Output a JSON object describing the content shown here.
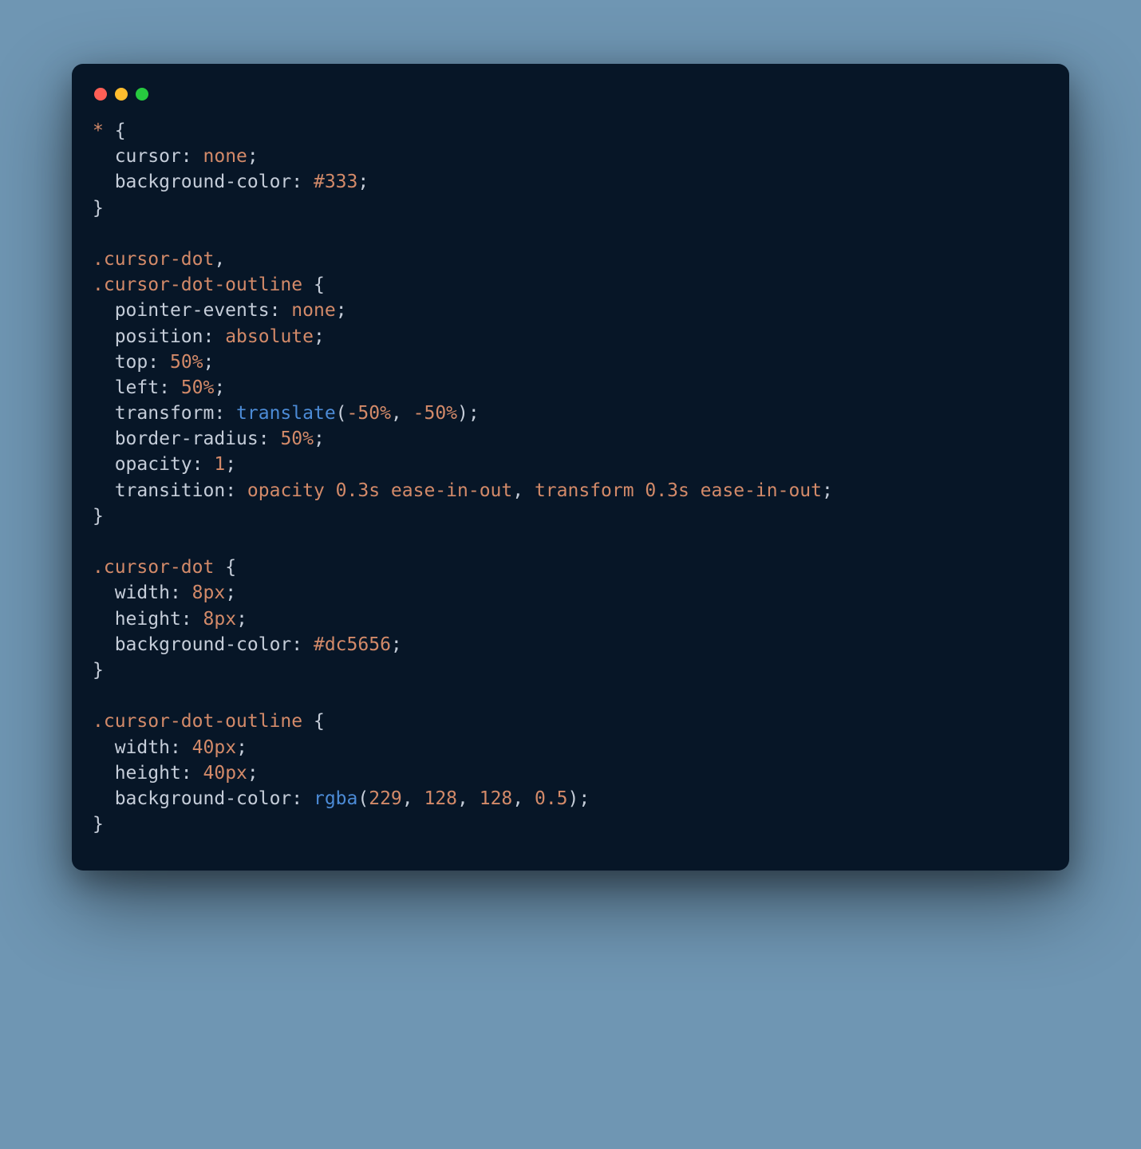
{
  "window": {
    "bg": "#071627",
    "traffic_lights": [
      "#ff5f56",
      "#ffbd2e",
      "#27c93f"
    ]
  },
  "code": {
    "rules": [
      {
        "selectors": [
          "*"
        ],
        "decls": [
          {
            "prop": "cursor",
            "tokens": [
              {
                "t": "val",
                "v": "none"
              }
            ]
          },
          {
            "prop": "background-color",
            "tokens": [
              {
                "t": "val",
                "v": "#333"
              }
            ]
          }
        ]
      },
      {
        "selectors": [
          ".cursor-dot",
          ".cursor-dot-outline"
        ],
        "decls": [
          {
            "prop": "pointer-events",
            "tokens": [
              {
                "t": "val",
                "v": "none"
              }
            ]
          },
          {
            "prop": "position",
            "tokens": [
              {
                "t": "val",
                "v": "absolute"
              }
            ]
          },
          {
            "prop": "top",
            "tokens": [
              {
                "t": "num",
                "v": "50%"
              }
            ]
          },
          {
            "prop": "left",
            "tokens": [
              {
                "t": "num",
                "v": "50%"
              }
            ]
          },
          {
            "prop": "transform",
            "tokens": [
              {
                "t": "func",
                "v": "translate"
              },
              {
                "t": "punc",
                "v": "("
              },
              {
                "t": "num",
                "v": "-50%"
              },
              {
                "t": "punc",
                "v": ", "
              },
              {
                "t": "num",
                "v": "-50%"
              },
              {
                "t": "punc",
                "v": ")"
              }
            ]
          },
          {
            "prop": "border-radius",
            "tokens": [
              {
                "t": "num",
                "v": "50%"
              }
            ]
          },
          {
            "prop": "opacity",
            "tokens": [
              {
                "t": "num",
                "v": "1"
              }
            ]
          },
          {
            "prop": "transition",
            "tokens": [
              {
                "t": "val",
                "v": "opacity 0.3s ease-in-out"
              },
              {
                "t": "punc",
                "v": ", "
              },
              {
                "t": "val",
                "v": "transform 0.3s ease-in-out"
              }
            ]
          }
        ]
      },
      {
        "selectors": [
          ".cursor-dot"
        ],
        "decls": [
          {
            "prop": "width",
            "tokens": [
              {
                "t": "num",
                "v": "8px"
              }
            ]
          },
          {
            "prop": "height",
            "tokens": [
              {
                "t": "num",
                "v": "8px"
              }
            ]
          },
          {
            "prop": "background-color",
            "tokens": [
              {
                "t": "val",
                "v": "#dc5656"
              }
            ]
          }
        ]
      },
      {
        "selectors": [
          ".cursor-dot-outline"
        ],
        "decls": [
          {
            "prop": "width",
            "tokens": [
              {
                "t": "num",
                "v": "40px"
              }
            ]
          },
          {
            "prop": "height",
            "tokens": [
              {
                "t": "num",
                "v": "40px"
              }
            ]
          },
          {
            "prop": "background-color",
            "tokens": [
              {
                "t": "func",
                "v": "rgba"
              },
              {
                "t": "punc",
                "v": "("
              },
              {
                "t": "num",
                "v": "229"
              },
              {
                "t": "punc",
                "v": ", "
              },
              {
                "t": "num",
                "v": "128"
              },
              {
                "t": "punc",
                "v": ", "
              },
              {
                "t": "num",
                "v": "128"
              },
              {
                "t": "punc",
                "v": ", "
              },
              {
                "t": "num",
                "v": "0.5"
              },
              {
                "t": "punc",
                "v": ")"
              }
            ]
          }
        ]
      }
    ]
  }
}
